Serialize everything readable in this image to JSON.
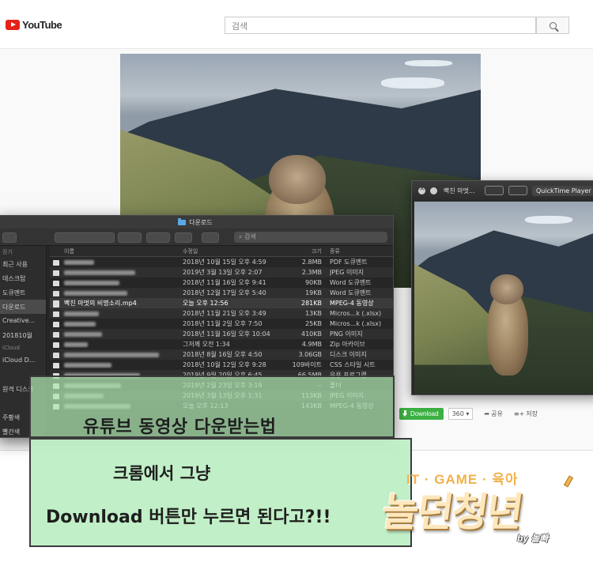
{
  "youtube": {
    "logo_text": "YouTube",
    "search_placeholder": "검색",
    "download_label": "Download",
    "quality": "360",
    "share_label": "공유",
    "save_label": "저장"
  },
  "quicktime": {
    "title": "빡친 마멋...",
    "app_name": "QuickTime Player"
  },
  "finder": {
    "title": "다운로드",
    "search_placeholder": "검색",
    "sidebar": [
      {
        "label": "장기",
        "header": true
      },
      {
        "label": "최근 사용"
      },
      {
        "label": "데스크탑"
      },
      {
        "label": "도큐멘트"
      },
      {
        "label": "다운로드",
        "selected": true
      },
      {
        "label": "Creative..."
      },
      {
        "label": "201810월"
      },
      {
        "label": "iCloud",
        "header": true
      },
      {
        "label": "iCloud D..."
      },
      {
        "label": ""
      },
      {
        "label": "원격 디스크"
      },
      {
        "label": ""
      },
      {
        "label": "주황색"
      },
      {
        "label": "빨간색"
      }
    ],
    "columns": {
      "name": "이름",
      "date": "수정일",
      "size": "크기",
      "kind": "종류"
    },
    "rows": [
      {
        "name": "",
        "date": "2018년 10월 15일 오후 4:59",
        "size": "2.8MB",
        "kind": "PDF 도큐멘트"
      },
      {
        "name": "",
        "date": "2019년 3월 13일 오후 2:07",
        "size": "2.3MB",
        "kind": "JPEG 이미지"
      },
      {
        "name": "",
        "date": "2018년 11월 16일 오후 9:41",
        "size": "90KB",
        "kind": "Word 도큐멘트"
      },
      {
        "name": "",
        "date": "2018년 12월 17일 오후 5:40",
        "size": "19KB",
        "kind": "Word 도큐멘트"
      },
      {
        "name": "빡친 마멋의 비명소리.mp4",
        "date": "오늘 오후 12:56",
        "size": "281KB",
        "kind": "MPEG-4 동영상",
        "highlight": true
      },
      {
        "name": "",
        "date": "2018년 11월 21일 오후 3:49",
        "size": "13KB",
        "kind": "Micros...k (.xlsx)"
      },
      {
        "name": "",
        "date": "2018년 11월 2일 오후 7:50",
        "size": "25KB",
        "kind": "Micros...k (.xlsx)"
      },
      {
        "name": "",
        "date": "2018년 11월 16일 오후 10:04",
        "size": "410KB",
        "kind": "PNG 이미지"
      },
      {
        "name": "",
        "date": "그저께 오전 1:34",
        "size": "4.9MB",
        "kind": "Zip 아카이브"
      },
      {
        "name": "",
        "date": "2018년 8월 16일 오후 4:50",
        "size": "3.06GB",
        "kind": "디스크 이미지"
      },
      {
        "name": "",
        "date": "2018년 10월 12일 오후 9:28",
        "size": "109바이트",
        "kind": "CSS 스타일 시트"
      },
      {
        "name": "",
        "date": "2019년 9월 20일 오후 6:45",
        "size": "66.5MB",
        "kind": "응용 프로그램"
      },
      {
        "name": "",
        "date": "2019년 2월 23일 오후 3:19",
        "size": "--",
        "kind": "폴더"
      },
      {
        "name": "",
        "date": "2019년 3월 13일 오후 1:31",
        "size": "113KB",
        "kind": "JPEG 이미지"
      },
      {
        "name": "",
        "date": "오늘 오후 12:13",
        "size": "143KB",
        "kind": "MPEG-4 동영상"
      }
    ]
  },
  "captions": {
    "line1": "유튜브 동영상 다운받는법",
    "line2": "크롬에서 그냥",
    "line3": "Download 버튼만 누르면 된다고?!!"
  },
  "brand": {
    "tagline": "IT · GAME · 육아",
    "name": "놀던청년",
    "by": "by 놀빠"
  }
}
